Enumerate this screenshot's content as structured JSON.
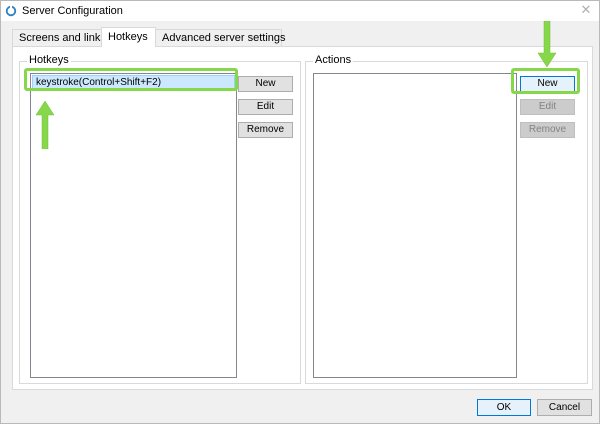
{
  "window": {
    "title": "Server Configuration"
  },
  "tabs": [
    {
      "label": "Screens and links",
      "active": false
    },
    {
      "label": "Hotkeys",
      "active": true
    },
    {
      "label": "Advanced server settings",
      "active": false
    }
  ],
  "hotkeys": {
    "group_label": "Hotkeys",
    "items": [
      "keystroke(Control+Shift+F2)"
    ],
    "buttons": {
      "new": "New",
      "edit": "Edit",
      "remove": "Remove"
    }
  },
  "actions": {
    "group_label": "Actions",
    "items": [],
    "buttons": {
      "new": "New",
      "edit": "Edit",
      "remove": "Remove"
    }
  },
  "footer": {
    "ok": "OK",
    "cancel": "Cancel"
  },
  "colors": {
    "highlight": "#86d84a",
    "selection": "#cce8ff",
    "accent": "#0078d7"
  }
}
